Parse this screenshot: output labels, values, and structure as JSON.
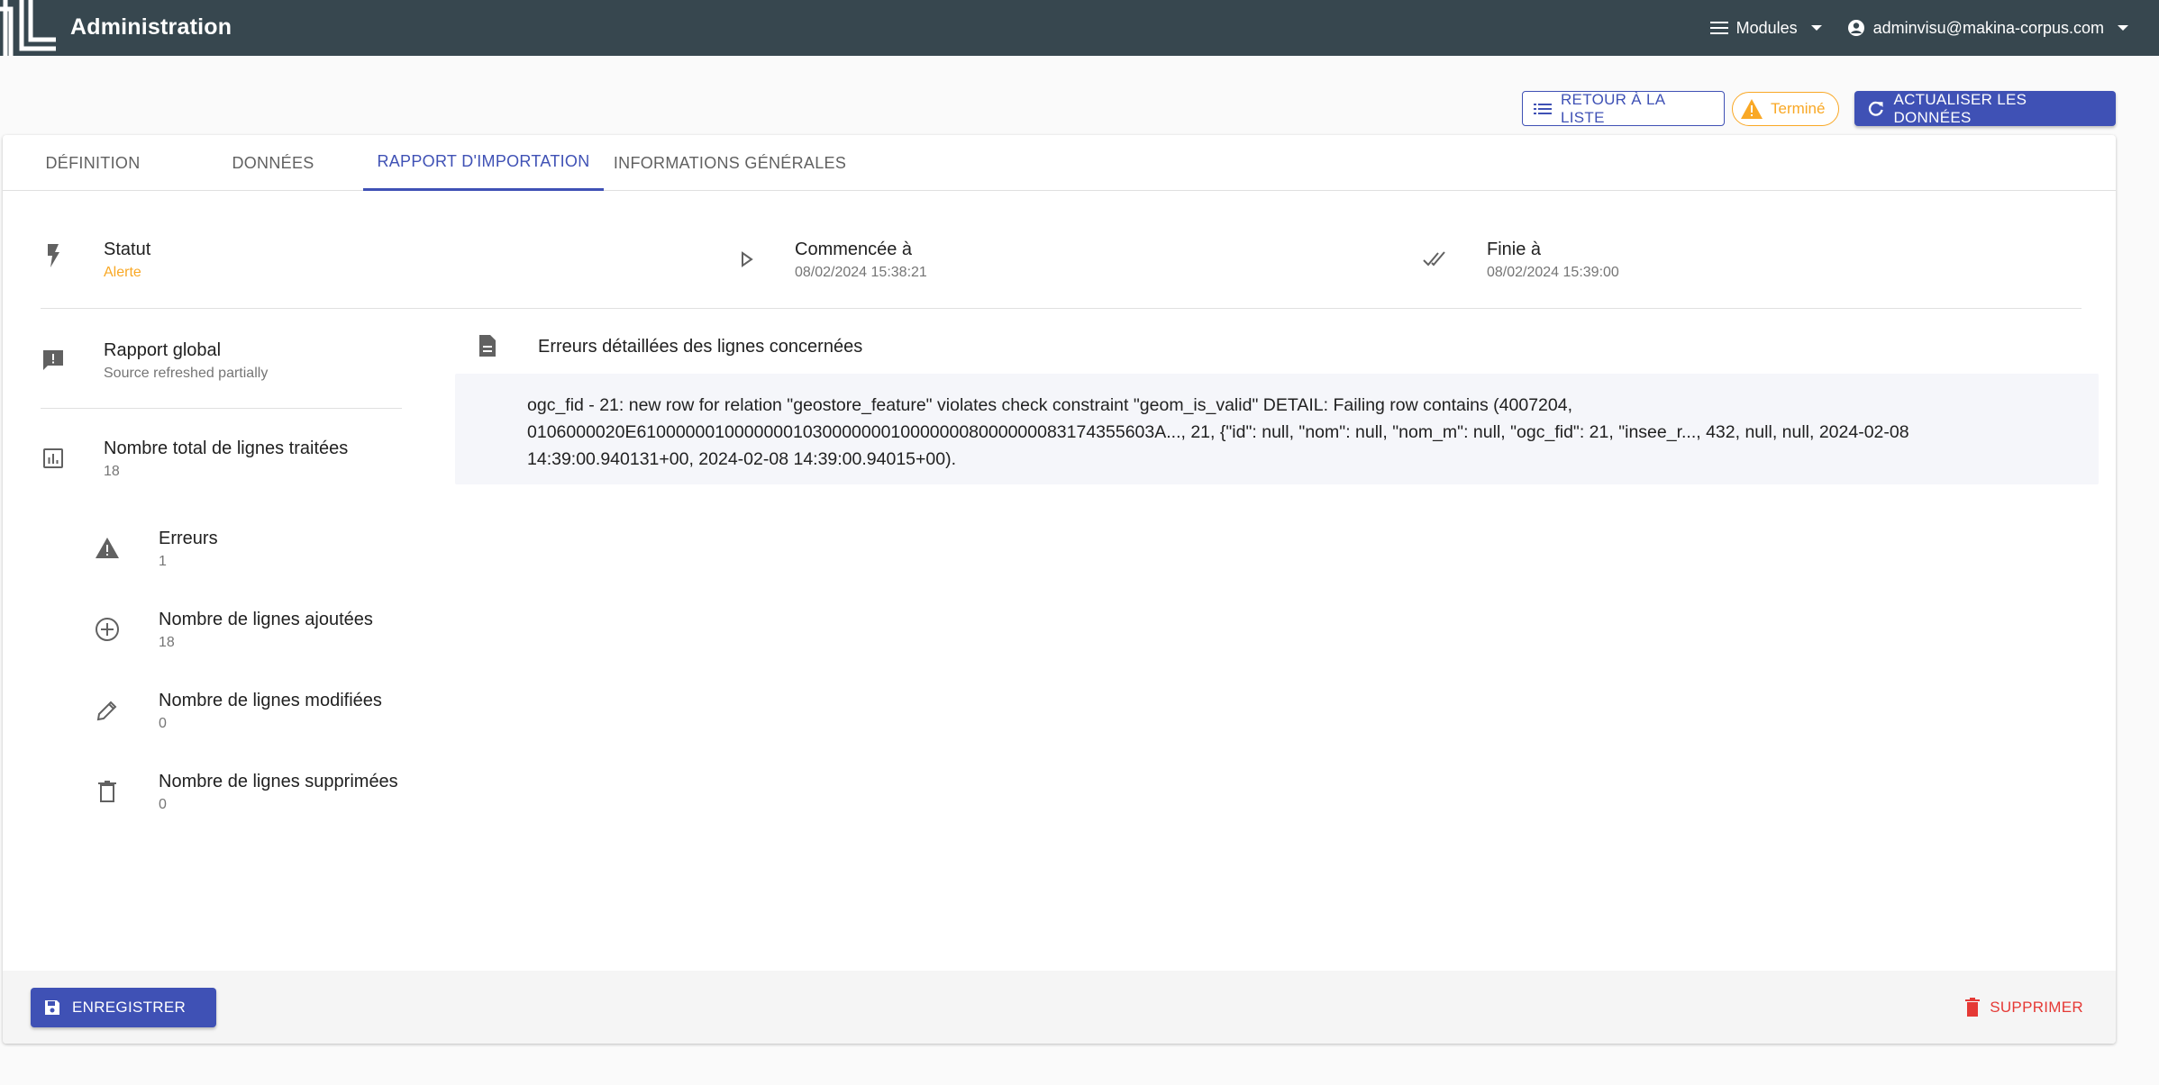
{
  "appbar": {
    "title": "Administration",
    "modules_label": "Modules",
    "user_label": "adminvisu@makina-corpus.com"
  },
  "actions": {
    "back_label": "RETOUR À LA LISTE",
    "status_label": "Terminé",
    "refresh_label": "ACTUALISER LES DONNÉES"
  },
  "tabs": [
    {
      "label": "DÉFINITION"
    },
    {
      "label": "DONNÉES"
    },
    {
      "label": "RAPPORT D'IMPORTATION"
    },
    {
      "label": "INFORMATIONS GÉNÉRALES"
    }
  ],
  "report": {
    "status_title": "Statut",
    "status_value": "Alerte",
    "started_title": "Commencée à",
    "started_value": "08/02/2024 15:38:21",
    "finished_title": "Finie à",
    "finished_value": "08/02/2024 15:39:00",
    "global_title": "Rapport global",
    "global_value": "Source refreshed partially",
    "total_title": "Nombre total de lignes traitées",
    "total_value": "18",
    "errors_title": "Erreurs",
    "errors_value": "1",
    "added_title": "Nombre de lignes ajoutées",
    "added_value": "18",
    "modified_title": "Nombre de lignes modifiées",
    "modified_value": "0",
    "deleted_title": "Nombre de lignes supprimées",
    "deleted_value": "0",
    "details_title": "Erreurs détaillées des lignes concernées",
    "error_line_1": "ogc_fid - 21: new row for relation \"geostore_feature\" violates check constraint \"geom_is_valid\" DETAIL: Failing row contains (4007204,",
    "error_line_2": "0106000020E61000000100000001030000000100000008000000083174355603A..., 21, {\"id\": null, \"nom\": null, \"nom_m\": null, \"ogc_fid\": 21, \"insee_r..., 432, null, null, 2024-02-08",
    "error_line_3": "14:39:00.940131+00, 2024-02-08 14:39:00.94015+00)."
  },
  "footer": {
    "save_label": "ENREGISTRER",
    "delete_label": "SUPPRIMER"
  },
  "colors": {
    "appbar": "#37474f",
    "primary": "#3f51b5",
    "warning": "#f9a825",
    "danger": "#e53935"
  }
}
